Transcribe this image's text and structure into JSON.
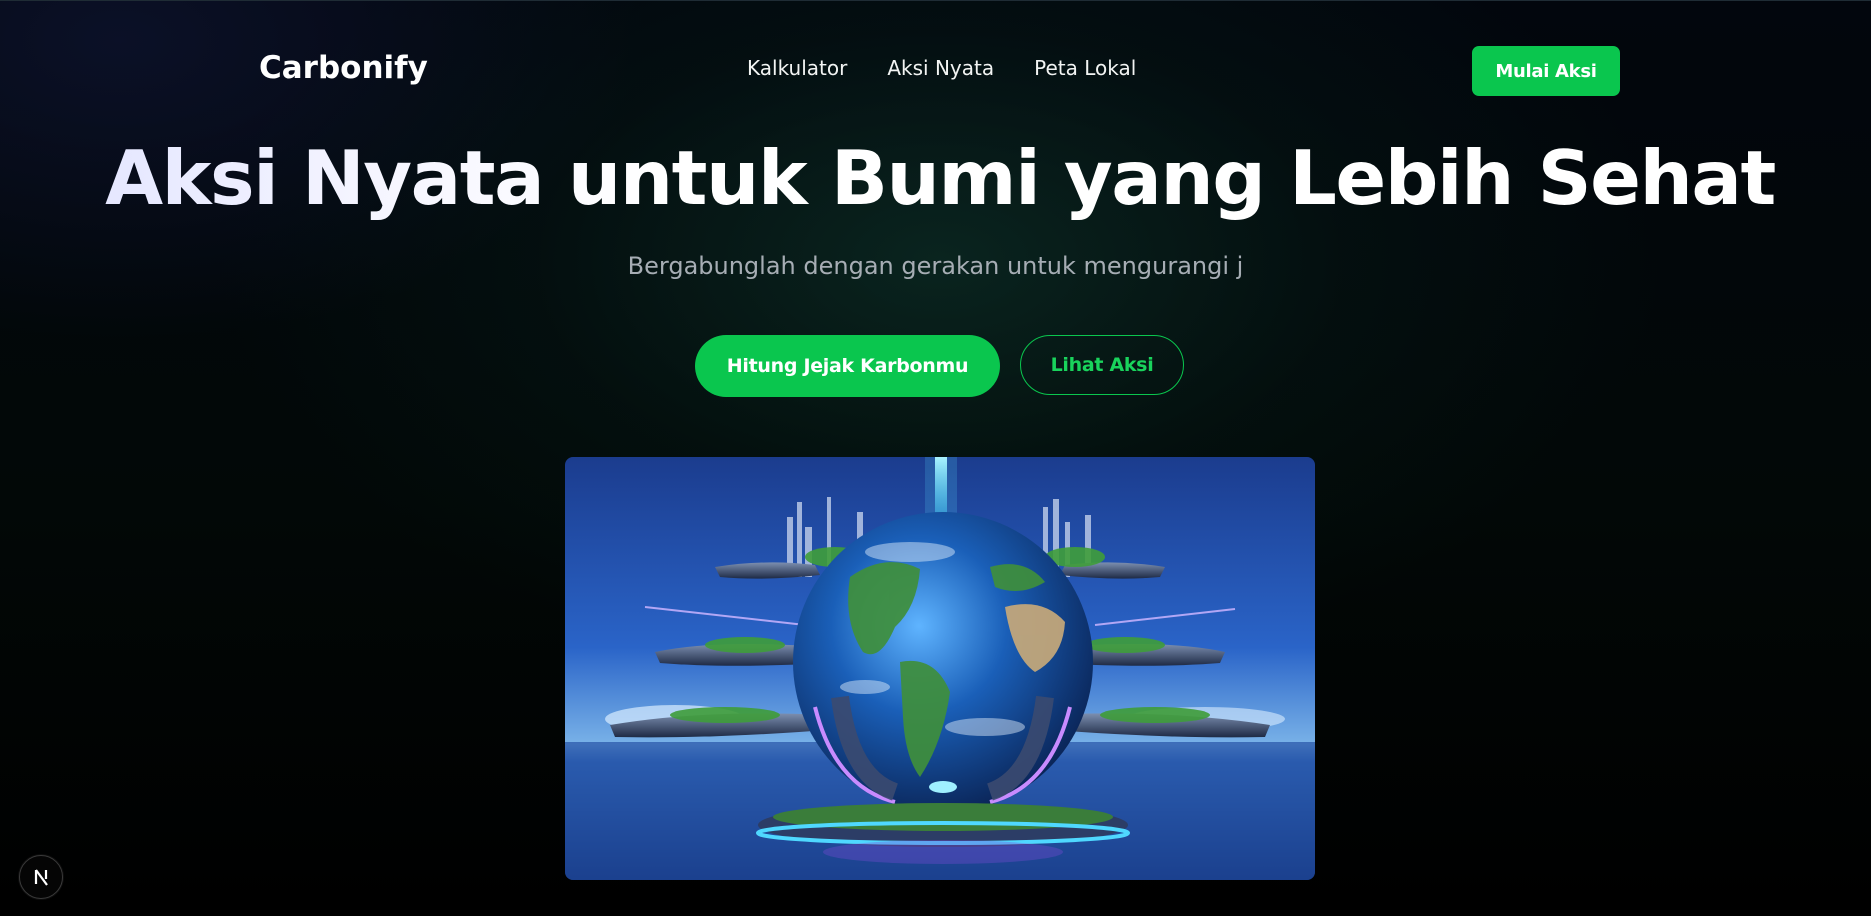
{
  "nav": {
    "logo": "Carbonify",
    "links": [
      "Kalkulator",
      "Aksi Nyata",
      "Peta Lokal"
    ],
    "cta": "Mulai Aksi"
  },
  "hero": {
    "title": "Aksi Nyata untuk Bumi yang Lebih Sehat",
    "subtitle": "Bergabunglah dengan gerakan untuk mengurangi j",
    "primary_button": "Hitung Jejak Karbonmu",
    "secondary_button": "Lihat Aksi"
  },
  "icons": {
    "hero_image": "futuristic-earth-city-illustration",
    "dev_badge": "nextjs-logo-icon"
  },
  "colors": {
    "accent": "#0ac64e",
    "background": "#000000",
    "subtitle": "#a6adb4"
  }
}
